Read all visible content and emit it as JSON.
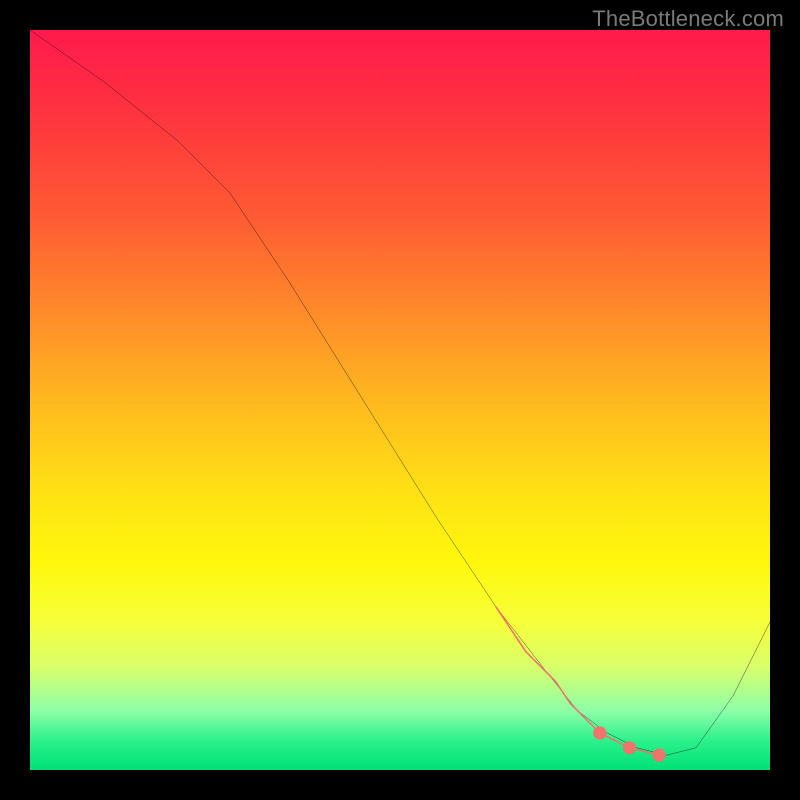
{
  "watermark": "TheBottleneck.com",
  "chart_data": {
    "type": "line",
    "title": "",
    "xlabel": "",
    "ylabel": "",
    "xlim": [
      0,
      100
    ],
    "ylim": [
      0,
      100
    ],
    "grid": false,
    "legend": false,
    "curve": {
      "name": "bottleneck-curve",
      "color": "#000000",
      "x": [
        0,
        10,
        20,
        27,
        35,
        45,
        55,
        63,
        70,
        74,
        78,
        82,
        86,
        90,
        95,
        100
      ],
      "y": [
        100,
        93,
        85,
        78,
        66,
        50,
        34,
        22,
        13,
        8,
        5,
        3,
        2,
        3,
        10,
        20
      ]
    },
    "highlight_segment": {
      "name": "highlighted-range",
      "color": "#ef746b",
      "points_x": [
        63,
        65,
        67,
        69,
        71,
        73,
        75,
        77,
        79,
        81,
        83,
        85
      ],
      "points_y": [
        22,
        19,
        16,
        14,
        12,
        9,
        7,
        5,
        4,
        3,
        2.5,
        2
      ],
      "dots_x": [
        77,
        81,
        85
      ],
      "dots_y": [
        5,
        3,
        2
      ]
    },
    "gradient_stops": [
      {
        "pos": 0.0,
        "color": "#ff1a4d"
      },
      {
        "pos": 0.5,
        "color": "#ffe015"
      },
      {
        "pos": 0.96,
        "color": "#2cf28c"
      },
      {
        "pos": 1.0,
        "color": "#00e077"
      }
    ]
  }
}
